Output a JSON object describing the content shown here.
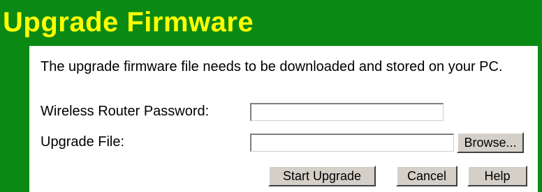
{
  "header": {
    "title": "Upgrade Firmware"
  },
  "form": {
    "description": "The upgrade firmware file needs to be downloaded and stored on your PC.",
    "password_label": "Wireless Router Password:",
    "password_value": "",
    "file_label": "Upgrade File:",
    "file_value": ""
  },
  "buttons": {
    "browse": "Browse...",
    "start_upgrade": "Start Upgrade",
    "cancel": "Cancel",
    "help": "Help"
  },
  "colors": {
    "header_bg": "#0a8a14",
    "title_text": "#ffff00",
    "button_face": "#d4d0c8"
  }
}
